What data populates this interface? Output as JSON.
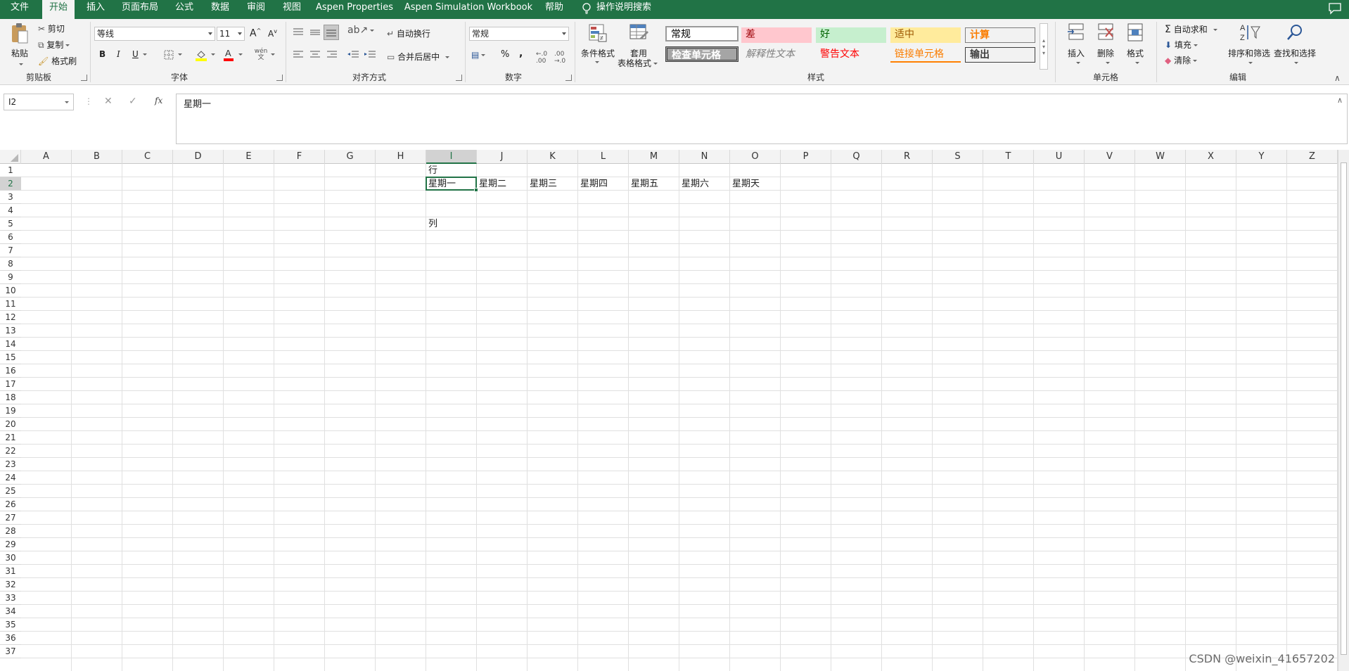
{
  "tabs": [
    "文件",
    "开始",
    "插入",
    "页面布局",
    "公式",
    "数据",
    "审阅",
    "视图",
    "Aspen Properties",
    "Aspen Simulation Workbook",
    "帮助",
    "操作说明搜索"
  ],
  "clipboard": {
    "paste": "粘贴",
    "cut": "剪切",
    "copy": "复制",
    "format_painter": "格式刷",
    "label": "剪贴板"
  },
  "font": {
    "name": "等线",
    "size": "11",
    "bold": "B",
    "italic": "I",
    "underline": "U",
    "label": "字体"
  },
  "alignment": {
    "wrap": "自动换行",
    "merge": "合并后居中",
    "label": "对齐方式"
  },
  "number": {
    "format": "常规",
    "percent": "%",
    "comma": ",",
    "label": "数字"
  },
  "styles": {
    "conditional": "条件格式",
    "table_format_line1": "套用",
    "table_format_line2": "表格格式",
    "gallery": [
      "常规",
      "差",
      "好",
      "适中",
      "计算",
      "检查单元格",
      "解释性文本",
      "警告文本",
      "链接单元格",
      "输出"
    ],
    "label": "样式"
  },
  "cells_group": {
    "insert": "插入",
    "delete": "删除",
    "format": "格式",
    "label": "单元格"
  },
  "editing": {
    "autosum": "自动求和",
    "fill": "填充",
    "clear": "清除",
    "sort": "排序和筛选",
    "find": "查找和选择",
    "label": "编辑"
  },
  "formula_bar": {
    "name_box": "I2",
    "cancel": "✕",
    "enter": "✓",
    "fx": "fx",
    "content": "星期一"
  },
  "columns": [
    "A",
    "B",
    "C",
    "D",
    "E",
    "F",
    "G",
    "H",
    "I",
    "J",
    "K",
    "L",
    "M",
    "N",
    "O",
    "P",
    "Q",
    "R",
    "S",
    "T",
    "U",
    "V",
    "W",
    "X",
    "Y",
    "Z"
  ],
  "rows": [
    "1",
    "2",
    "3",
    "4",
    "5",
    "6",
    "7",
    "8",
    "9",
    "10",
    "11",
    "12",
    "13",
    "14",
    "15",
    "16",
    "17",
    "18",
    "19",
    "20",
    "21",
    "22",
    "23",
    "24",
    "25",
    "26",
    "27",
    "28",
    "29",
    "30",
    "31",
    "32",
    "33",
    "34",
    "35",
    "36",
    "37"
  ],
  "selected": {
    "col": "I",
    "row": "2"
  },
  "cells": [
    {
      "ref": "I1",
      "text": "行"
    },
    {
      "ref": "I2",
      "text": "星期一"
    },
    {
      "ref": "J2",
      "text": "星期二"
    },
    {
      "ref": "K2",
      "text": "星期三"
    },
    {
      "ref": "L2",
      "text": "星期四"
    },
    {
      "ref": "M2",
      "text": "星期五"
    },
    {
      "ref": "N2",
      "text": "星期六"
    },
    {
      "ref": "O2",
      "text": "星期天"
    },
    {
      "ref": "I5",
      "text": "列"
    }
  ],
  "watermark": "CSDN @weixin_41657202",
  "colors": {
    "brand": "#217346",
    "bad_bg": "#ffc7ce",
    "bad_fg": "#9c0006",
    "good_bg": "#c6efce",
    "good_fg": "#006100",
    "neutral_bg": "#ffeb9c",
    "neutral_fg": "#9c5700",
    "calc_fg": "#fa7d00"
  }
}
